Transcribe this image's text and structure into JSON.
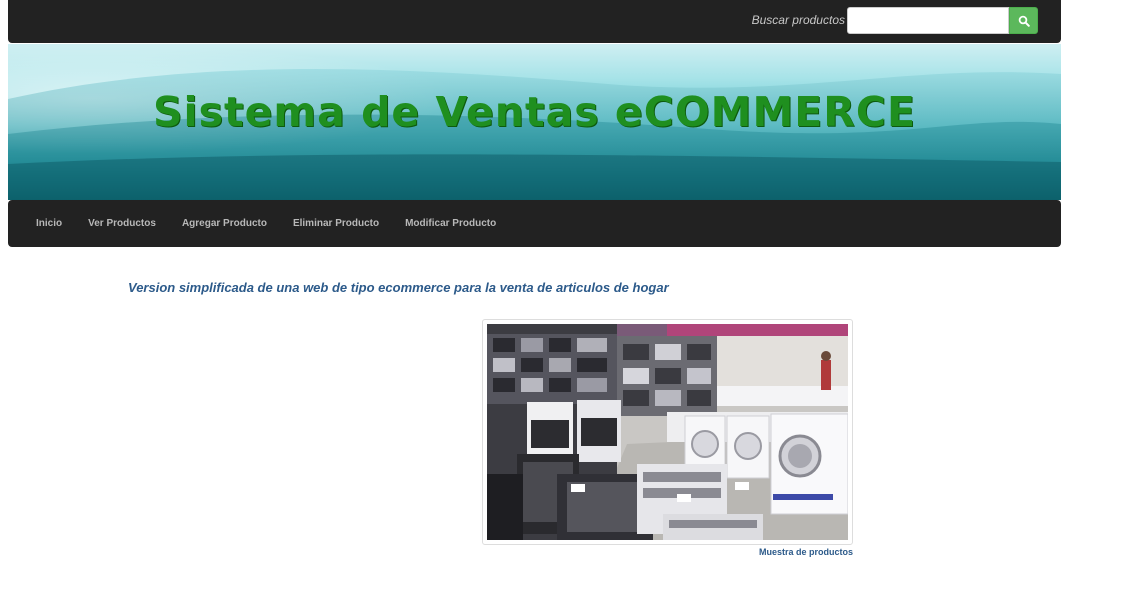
{
  "header": {
    "search_label": "Buscar productos",
    "search_placeholder": "",
    "search_value": "",
    "search_button_icon": "search-icon"
  },
  "banner": {
    "title": "Sistema de Ventas eCOMMERCE"
  },
  "nav": {
    "items": [
      {
        "label": "Inicio"
      },
      {
        "label": "Ver Productos"
      },
      {
        "label": "Agregar Producto"
      },
      {
        "label": "Eliminar Producto"
      },
      {
        "label": "Modificar Producto"
      }
    ]
  },
  "main": {
    "subtitle": "Version simplificada de una web de tipo ecommerce para la venta de articulos de hogar",
    "image_caption": "Muestra de productos"
  },
  "colors": {
    "bar_bg": "#222222",
    "search_button": "#5cb85c",
    "banner_title": "#1f8f1f",
    "text_link": "#2c5a8a"
  }
}
